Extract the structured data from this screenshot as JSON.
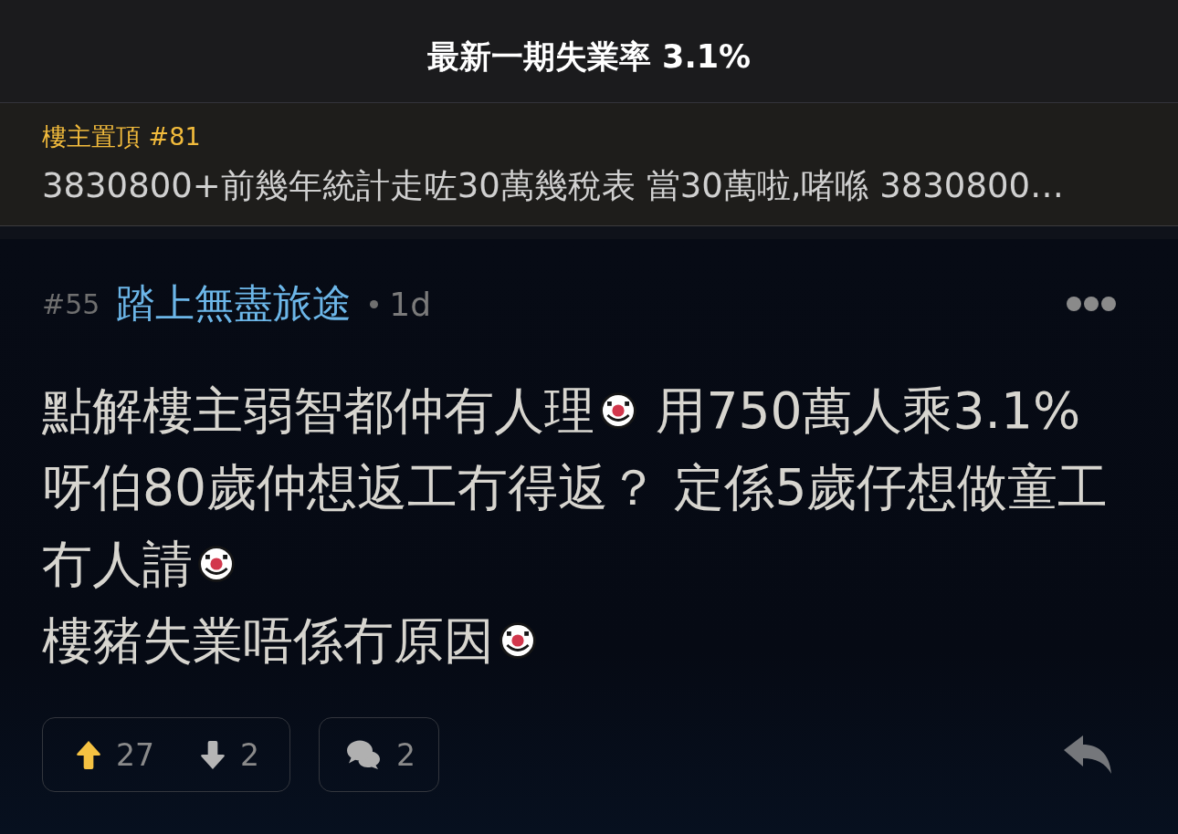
{
  "header": {
    "title": "最新一期失業率 3.1%"
  },
  "pinned": {
    "label": "樓主置頂 #81",
    "text": "3830800+前幾年統計走咗30萬幾稅表 當30萬啦,啫喺 3830800…"
  },
  "post": {
    "number": "#55",
    "author": "踏上無盡旅途",
    "time": "1d",
    "body_lines": [
      [
        {
          "kind": "text",
          "text": "點解樓主弱智都仲有人理"
        },
        {
          "kind": "emoji"
        },
        {
          "kind": "text",
          "text": " 用750萬人乘3.1%"
        }
      ],
      [
        {
          "kind": "text",
          "text": "呀伯80歲仲想返工冇得返？ 定係5歲仔想做童工"
        }
      ],
      [
        {
          "kind": "text",
          "text": "冇人請"
        },
        {
          "kind": "emoji"
        }
      ],
      [
        {
          "kind": "text",
          "text": "樓豬失業唔係冇原因"
        },
        {
          "kind": "emoji"
        }
      ]
    ],
    "votes": {
      "up": {
        "count": "27",
        "selected": true
      },
      "down": {
        "count": "2",
        "selected": false
      }
    },
    "comments": {
      "count": "2"
    }
  }
}
